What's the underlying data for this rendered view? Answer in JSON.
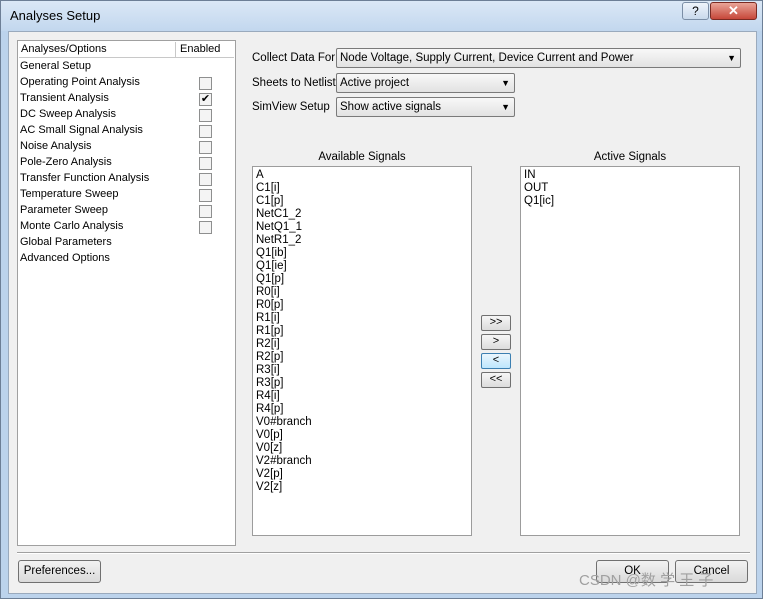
{
  "window": {
    "title": "Analyses Setup",
    "help_label": "?",
    "close_label": "✕"
  },
  "left_panel": {
    "header_col1": "Analyses/Options",
    "header_col2": "Enabled",
    "items": [
      {
        "label": "General Setup",
        "has_checkbox": false,
        "checked": false
      },
      {
        "label": "Operating Point Analysis",
        "has_checkbox": true,
        "checked": false
      },
      {
        "label": "Transient Analysis",
        "has_checkbox": true,
        "checked": true
      },
      {
        "label": "DC Sweep Analysis",
        "has_checkbox": true,
        "checked": false
      },
      {
        "label": "AC Small Signal Analysis",
        "has_checkbox": true,
        "checked": false
      },
      {
        "label": "Noise Analysis",
        "has_checkbox": true,
        "checked": false
      },
      {
        "label": "Pole-Zero Analysis",
        "has_checkbox": true,
        "checked": false
      },
      {
        "label": "Transfer Function Analysis",
        "has_checkbox": true,
        "checked": false
      },
      {
        "label": "Temperature Sweep",
        "has_checkbox": true,
        "checked": false
      },
      {
        "label": "Parameter Sweep",
        "has_checkbox": true,
        "checked": false
      },
      {
        "label": "Monte Carlo Analysis",
        "has_checkbox": true,
        "checked": false
      },
      {
        "label": "Global Parameters",
        "has_checkbox": false,
        "checked": false
      },
      {
        "label": "Advanced Options",
        "has_checkbox": false,
        "checked": false
      }
    ]
  },
  "settings": {
    "collect_label": "Collect Data For",
    "collect_value": "Node Voltage, Supply Current, Device Current and Power",
    "sheets_label": "Sheets to Netlist",
    "sheets_value": "Active project",
    "simview_label": "SimView Setup",
    "simview_value": "Show active signals"
  },
  "available": {
    "caption": "Available Signals",
    "items": [
      "A",
      "C1[i]",
      "C1[p]",
      "NetC1_2",
      "NetQ1_1",
      "NetR1_2",
      "Q1[ib]",
      "Q1[ie]",
      "Q1[p]",
      "R0[i]",
      "R0[p]",
      "R1[i]",
      "R1[p]",
      "R2[i]",
      "R2[p]",
      "R3[i]",
      "R3[p]",
      "R4[i]",
      "R4[p]",
      "V0#branch",
      "V0[p]",
      "V0[z]",
      "V2#branch",
      "V2[p]",
      "V2[z]"
    ]
  },
  "active": {
    "caption": "Active Signals",
    "items": [
      "IN",
      "OUT",
      "Q1[ic]"
    ]
  },
  "move_buttons": {
    "add_all": ">>",
    "add": ">",
    "remove": "<",
    "remove_all": "<<"
  },
  "footer": {
    "preferences": "Preferences...",
    "ok": "OK",
    "cancel": "Cancel"
  },
  "watermark": "CSDN @数 学 王 子"
}
